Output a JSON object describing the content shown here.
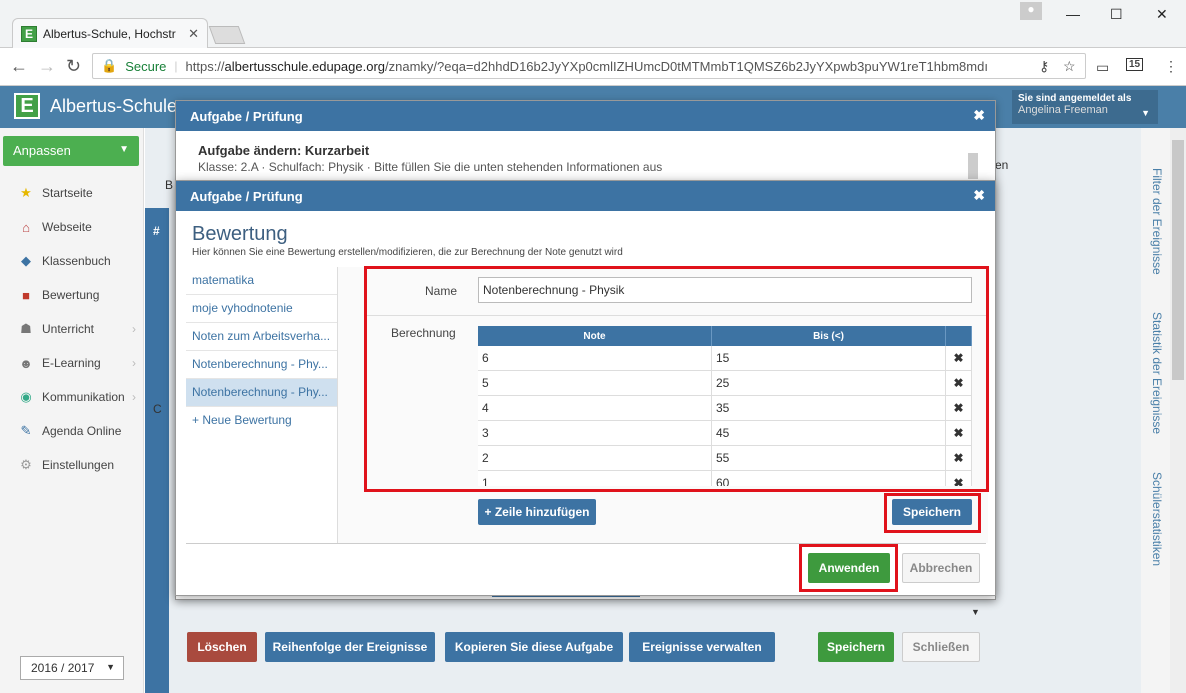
{
  "browser": {
    "tab_title": "Albertus-Schule, Hochstr",
    "secure_label": "Secure",
    "url_scheme": "https://",
    "url_host": "albertusschule.edupage.org",
    "url_path": "/znamky/?eqa=d2hhdD16b2JyYXp0cmlIZHUmcD0tMTMmbT1QMSZ6b2JyYXpwb3puYW1reT1hbm8mdı",
    "ext_badge": "15"
  },
  "app": {
    "title": "Albertus-Schule,",
    "logo_letter": "E",
    "user_label": "Sie sind angemeldet als",
    "user_name": "Angelina Freeman"
  },
  "sidebar": {
    "customize_label": "Anpassen",
    "items": [
      {
        "label": "Startseite",
        "icon": "star-icon"
      },
      {
        "label": "Webseite",
        "icon": "house-icon"
      },
      {
        "label": "Klassenbuch",
        "icon": "book-icon"
      },
      {
        "label": "Bewertung",
        "icon": "grade-icon"
      },
      {
        "label": "Unterricht",
        "icon": "teacher-icon"
      },
      {
        "label": "E-Learning",
        "icon": "elearning-icon"
      },
      {
        "label": "Kommunikation",
        "icon": "globe-icon"
      },
      {
        "label": "Agenda Online",
        "icon": "pen-icon"
      },
      {
        "label": "Einstellungen",
        "icon": "gear-icon"
      }
    ],
    "year": "2016 / 2017"
  },
  "right_panel": {
    "filter_label": "Filter der Ereignisse",
    "stats_label": "Statistik der Ereignisse",
    "student_stats_label": "Schülerstatistiken"
  },
  "background": {
    "col_hash": "#",
    "row_letter": "C",
    "col_b": "B",
    "col_en": "en"
  },
  "modal1": {
    "header": "Aufgabe / Prüfung",
    "title": "Aufgabe ändern: Kurzarbeit",
    "subtitle": "Klasse: 2.A · Schulfach: Physik · Bitte füllen Sie die unten stehenden Informationen aus",
    "buttons": {
      "delete": "Löschen",
      "order": "Reihenfolge der Ereignisse",
      "copy": "Kopieren Sie diese Aufgabe",
      "manage": "Ereignisse verwalten",
      "save": "Speichern",
      "close": "Schließen"
    }
  },
  "modal2": {
    "header": "Aufgabe / Prüfung",
    "title": "Bewertung",
    "description": "Hier können Sie eine Bewertung erstellen/modifizieren, die zur Berechnung der Note genutzt wird",
    "list": [
      "matematika",
      "moje vyhodnotenie",
      "Noten zum Arbeitsverha...",
      "Notenberechnung - Phy...",
      "Notenberechnung - Phy..."
    ],
    "new_item": "+ Neue Bewertung",
    "name_label": "Name",
    "name_value": "Notenberechnung - Physik",
    "calc_label": "Berechnung",
    "table_headers": [
      "Note",
      "Bis (<)"
    ],
    "rows": [
      {
        "note": "6",
        "bis": "15"
      },
      {
        "note": "5",
        "bis": "25"
      },
      {
        "note": "4",
        "bis": "35"
      },
      {
        "note": "3",
        "bis": "45"
      },
      {
        "note": "2",
        "bis": "55"
      },
      {
        "note": "1",
        "bis": "60"
      }
    ],
    "add_row": "+ Zeile hinzufügen",
    "save": "Speichern",
    "apply": "Anwenden",
    "cancel": "Abbrechen"
  },
  "colors": {
    "header_blue": "#4a7fa8",
    "modal_blue": "#3d73a3",
    "green": "#3e9a3e",
    "highlight_red": "#e0121b"
  }
}
